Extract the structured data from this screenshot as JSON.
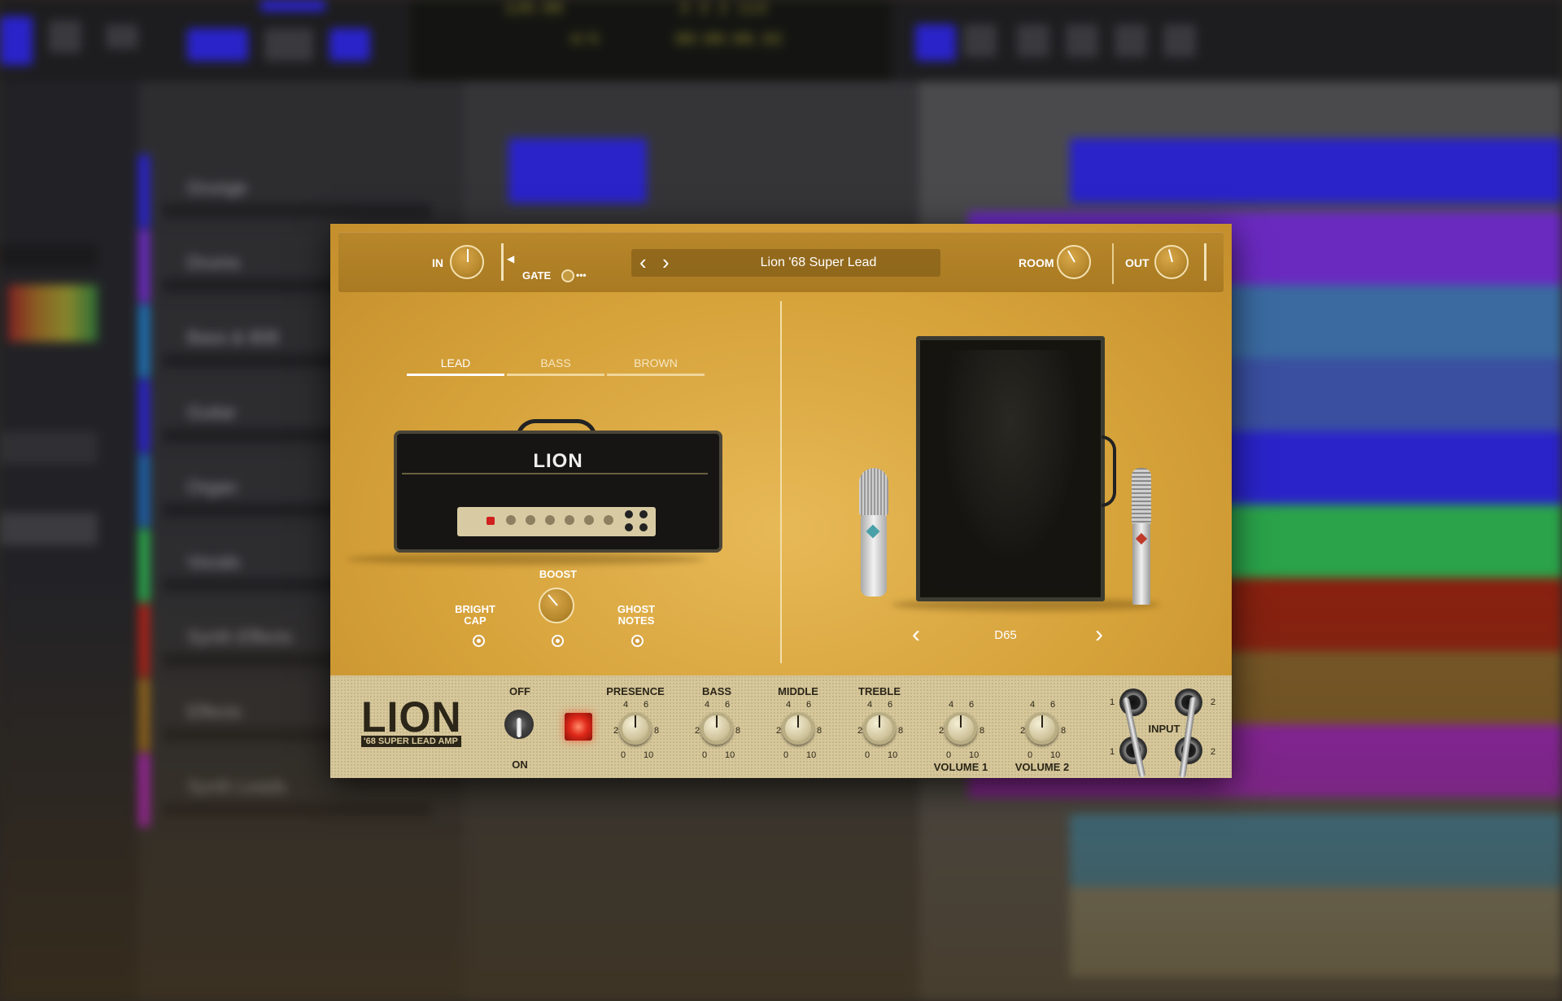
{
  "daw_background": {
    "tracks": [
      "Grunge",
      "Drums",
      "Bass & 808",
      "Guitar",
      "Organ",
      "Vocals",
      "Synth Effects",
      "Effects",
      "Synth Leads"
    ],
    "track_colors": [
      "#2a23c9",
      "#6a2ac0",
      "#1e6fb3",
      "#2a23c9",
      "#1e5fa8",
      "#2aa34a",
      "#b0201a",
      "#9a6a1e",
      "#b020c0"
    ],
    "lcd": {
      "tempo": "120.00",
      "sig": "4/4",
      "bar": "3  3  2  113",
      "time": "00:00:08.82"
    }
  },
  "plugin": {
    "toolbar": {
      "in_label": "IN",
      "gate_label": "GATE",
      "more_label": "•••",
      "preset_prev": "‹",
      "preset_next": "›",
      "preset_name": "Lion '68 Super Lead",
      "room_label": "ROOM",
      "out_label": "OUT"
    },
    "tabs": [
      {
        "label": "LEAD",
        "active": true
      },
      {
        "label": "BASS",
        "active": false
      },
      {
        "label": "BROWN",
        "active": false
      }
    ],
    "amp_logo": "LION",
    "switches": {
      "bright_cap": "BRIGHT CAP",
      "boost": "BOOST",
      "ghost_notes": "GHOST NOTES"
    },
    "cabinet": {
      "name": "D65",
      "prev": "‹",
      "next": "›"
    },
    "faceplate": {
      "brand": "LION",
      "brand_sub": "'68 SUPER LEAD AMP",
      "power_off": "OFF",
      "power_on": "ON",
      "knobs": [
        {
          "label": "PRESENCE",
          "bottom": "",
          "value": 5
        },
        {
          "label": "BASS",
          "bottom": "",
          "value": 5
        },
        {
          "label": "MIDDLE",
          "bottom": "",
          "value": 5
        },
        {
          "label": "TREBLE",
          "bottom": "",
          "value": 5
        },
        {
          "label": "",
          "bottom": "VOLUME 1",
          "value": 5
        },
        {
          "label": "",
          "bottom": "VOLUME 2",
          "value": 5
        }
      ],
      "scale": {
        "n0": "0",
        "n2": "2",
        "n4": "4",
        "n6": "6",
        "n8": "8",
        "n10": "10"
      },
      "input_label": "INPUT",
      "jack_numbers": {
        "a": "1",
        "b": "2",
        "c": "1",
        "d": "2"
      }
    },
    "colors": {
      "panel": "#d6a23a",
      "toolbar": "#a97a22",
      "faceplate": "#d7c89b",
      "power_light": "#e02a1a"
    }
  }
}
